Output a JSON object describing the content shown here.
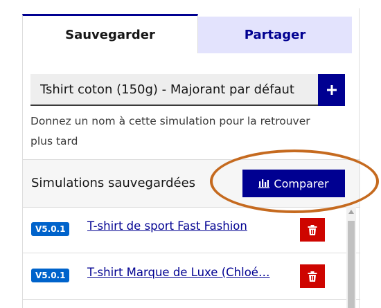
{
  "tabs": [
    {
      "label": "Sauvegarder",
      "active": true
    },
    {
      "label": "Partager",
      "active": false
    }
  ],
  "save_form": {
    "name_value": "Tshirt coton (150g) - Majorant par défaut",
    "add_icon": "plus-icon",
    "hint": "Donnez un nom à cette simulation pour la retrouver plus tard"
  },
  "saved": {
    "title": "Simulations sauvegardées",
    "compare_label": "Comparer",
    "compare_icon": "bar-chart-icon",
    "items": [
      {
        "version": "V5.0.1",
        "name": "T-shirt de sport Fast Fashion",
        "delete_icon": "trash-icon"
      },
      {
        "version": "V5.0.1",
        "name": "T-shirt Marque de Luxe (Chloé…",
        "delete_icon": "trash-icon"
      }
    ]
  },
  "colors": {
    "primary": "#000091",
    "tab_inactive_bg": "#e3e3fd",
    "badge": "#0063cb",
    "danger": "#ce0500",
    "annotation": "#c56a1f"
  }
}
